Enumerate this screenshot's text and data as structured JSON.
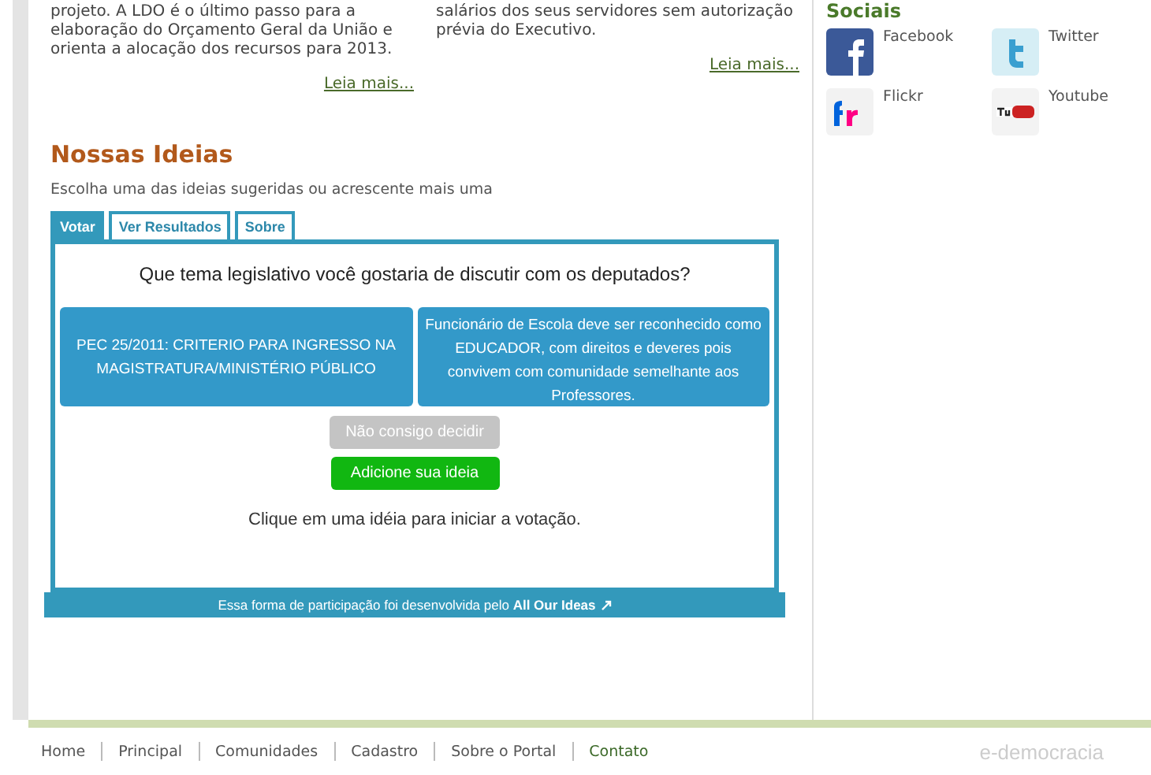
{
  "news": [
    {
      "lines": [
        "projeto. A LDO é o último passo para a",
        "elaboração do Orçamento Geral da União e",
        "orienta a alocação dos recursos para 2013."
      ],
      "link": "Leia mais..."
    },
    {
      "lines": [
        "salários dos seus servidores sem autorização",
        "prévia do Executivo."
      ],
      "link": "Leia mais..."
    }
  ],
  "ideas": {
    "title": "Nossas Ideias",
    "subtitle": "Escolha uma das ideias sugeridas ou acrescente mais uma",
    "tabs": [
      {
        "label": "Votar",
        "selected": true
      },
      {
        "label": "Ver Resultados",
        "selected": false
      },
      {
        "label": "Sobre",
        "selected": false
      }
    ],
    "question": "Que tema legislativo você gostaria de discutir com os deputados?",
    "choices": [
      "PEC 25/2011: CRITERIO PARA INGRESSO NA MAGISTRATURA/MINISTÉRIO PÚBLICO",
      "Funcionário de Escola deve ser reconhecido como EDUCADOR, com direitos e deveres pois convivem com comunidade semelhante aos Professores."
    ],
    "buttons": [
      {
        "label": "Não consigo decidir",
        "kind": "skip"
      },
      {
        "label": "Adicione sua ideia",
        "kind": "add"
      }
    ],
    "hint": "Clique em uma idéia para iniciar a votação.",
    "footer": "Essa forma de participação foi desenvolvida pelo **All Our Ideas**"
  },
  "socials": {
    "title": "Sociais",
    "items": [
      {
        "label": "Facebook",
        "kind": "facebook"
      },
      {
        "label": "Twitter",
        "kind": "twitter"
      },
      {
        "label": "Flickr",
        "kind": "flickr"
      },
      {
        "label": "Youtube",
        "kind": "youtube"
      }
    ]
  },
  "footer": {
    "links": [
      "Home",
      "Principal",
      "Comunidades",
      "Cadastro",
      "Sobre o Portal",
      "Contato"
    ],
    "brand": "e-democracia"
  }
}
